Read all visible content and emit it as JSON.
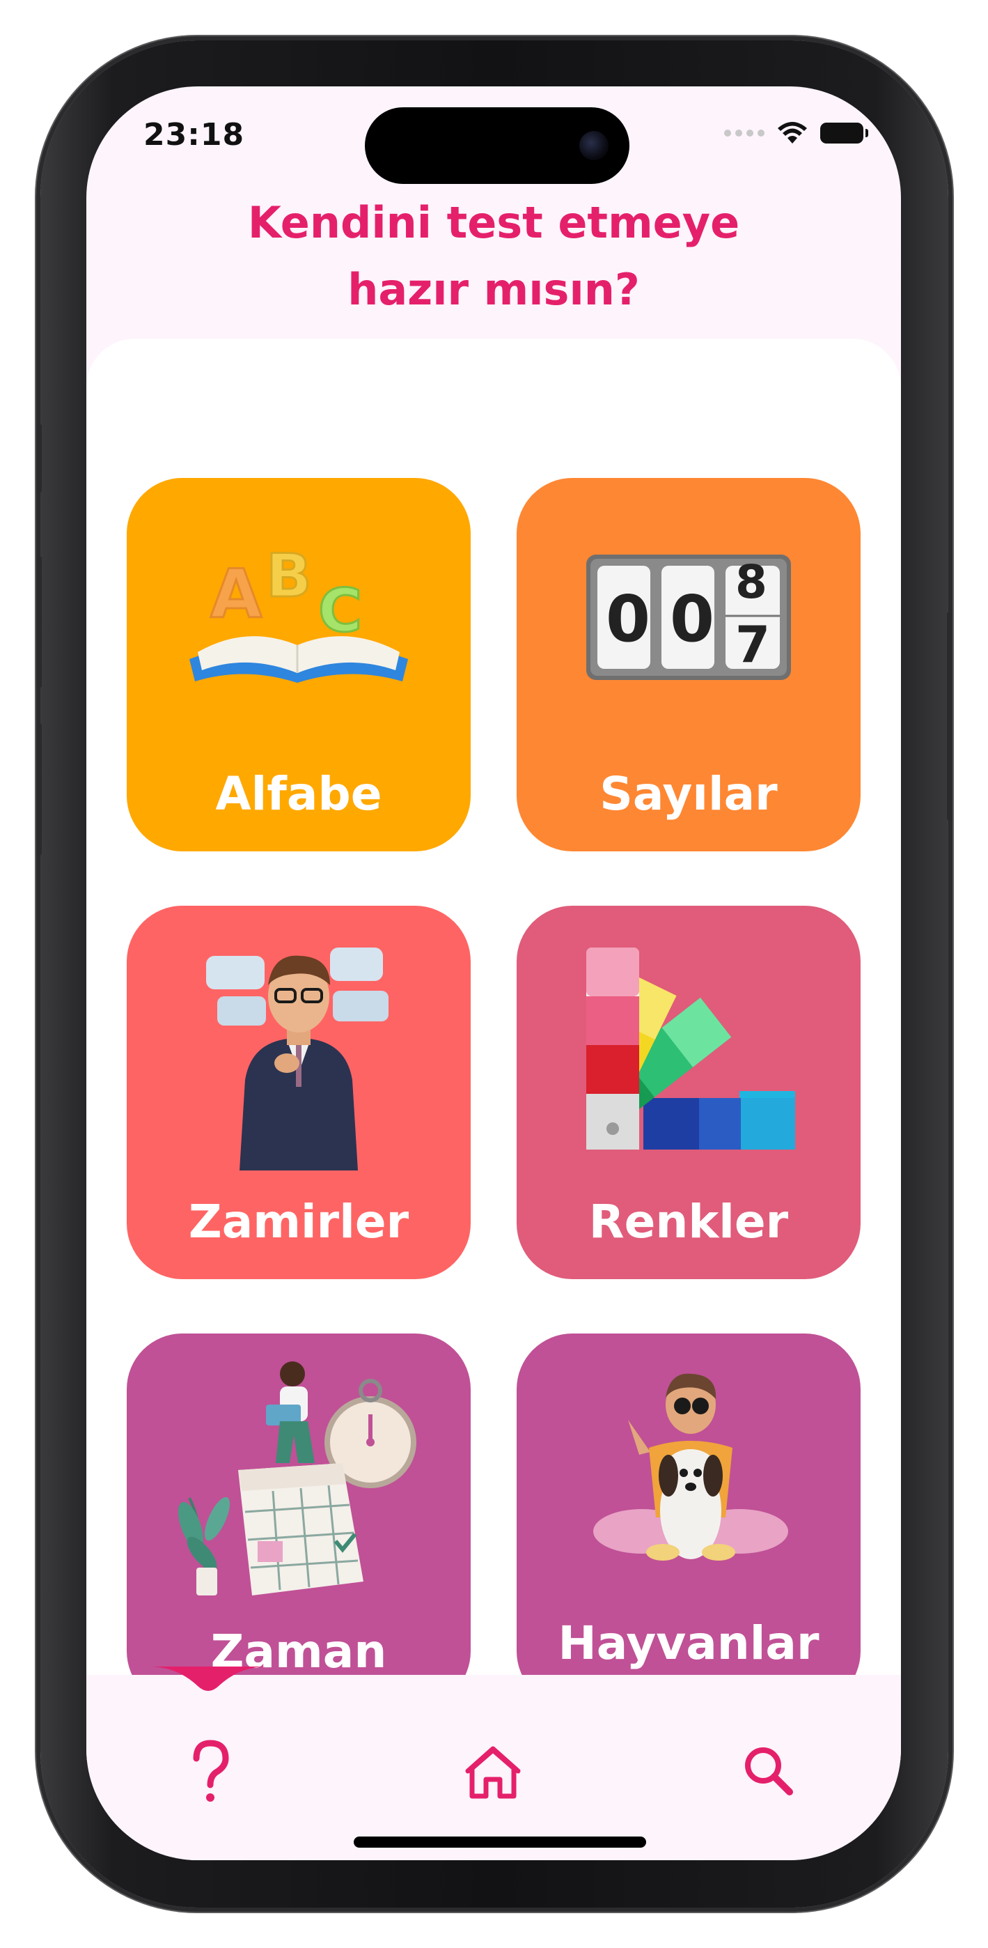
{
  "status_bar": {
    "time": "23:18"
  },
  "header": {
    "title_line1": "Kendini test etmeye",
    "title_line2": "hazır mısın?",
    "color": "#e5206b"
  },
  "categories": [
    {
      "label": "Alfabe",
      "color": "#ffa800",
      "icon": "abc-book-icon"
    },
    {
      "label": "Sayılar",
      "color": "#fe8733",
      "icon": "number-counter-icon"
    },
    {
      "label": "Zamirler",
      "color": "#ff6464",
      "icon": "thinking-man-icon"
    },
    {
      "label": "Renkler",
      "color": "#e05c7a",
      "icon": "color-palette-icon"
    },
    {
      "label": "Zaman",
      "color": "#c05196",
      "icon": "calendar-clock-icon"
    },
    {
      "label": "Hayvanlar",
      "color": "#c05196",
      "icon": "girl-with-dog-icon"
    }
  ],
  "counter_digits": [
    "0",
    "0",
    "8",
    "7"
  ],
  "bottom_nav": [
    {
      "name": "quiz",
      "icon": "question-mark-icon"
    },
    {
      "name": "home",
      "icon": "home-icon"
    },
    {
      "name": "search",
      "icon": "search-icon"
    }
  ],
  "colors": {
    "accent": "#e5206b",
    "screen_bg": "#fdf4fc"
  }
}
